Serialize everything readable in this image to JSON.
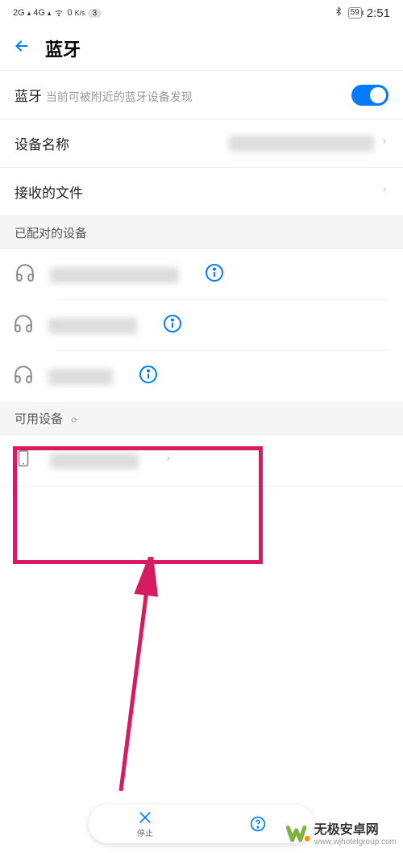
{
  "status": {
    "left1": "2G",
    "left2": "4G",
    "speed": "0",
    "speed_unit": "K/s",
    "notif_count": "3",
    "battery": "59",
    "time": "2:51"
  },
  "header": {
    "title": "蓝牙"
  },
  "rows": {
    "bluetooth_label": "蓝牙",
    "bluetooth_sub": "当前可被附近的蓝牙设备发现",
    "device_name_label": "设备名称",
    "received_files_label": "接收的文件"
  },
  "sections": {
    "paired_header": "已配对的设备",
    "available_header": "可用设备"
  },
  "bottom": {
    "stop_label": "停止"
  },
  "watermark": {
    "brand": "无极安卓网",
    "url": "www.wjhotelgroup.com"
  }
}
